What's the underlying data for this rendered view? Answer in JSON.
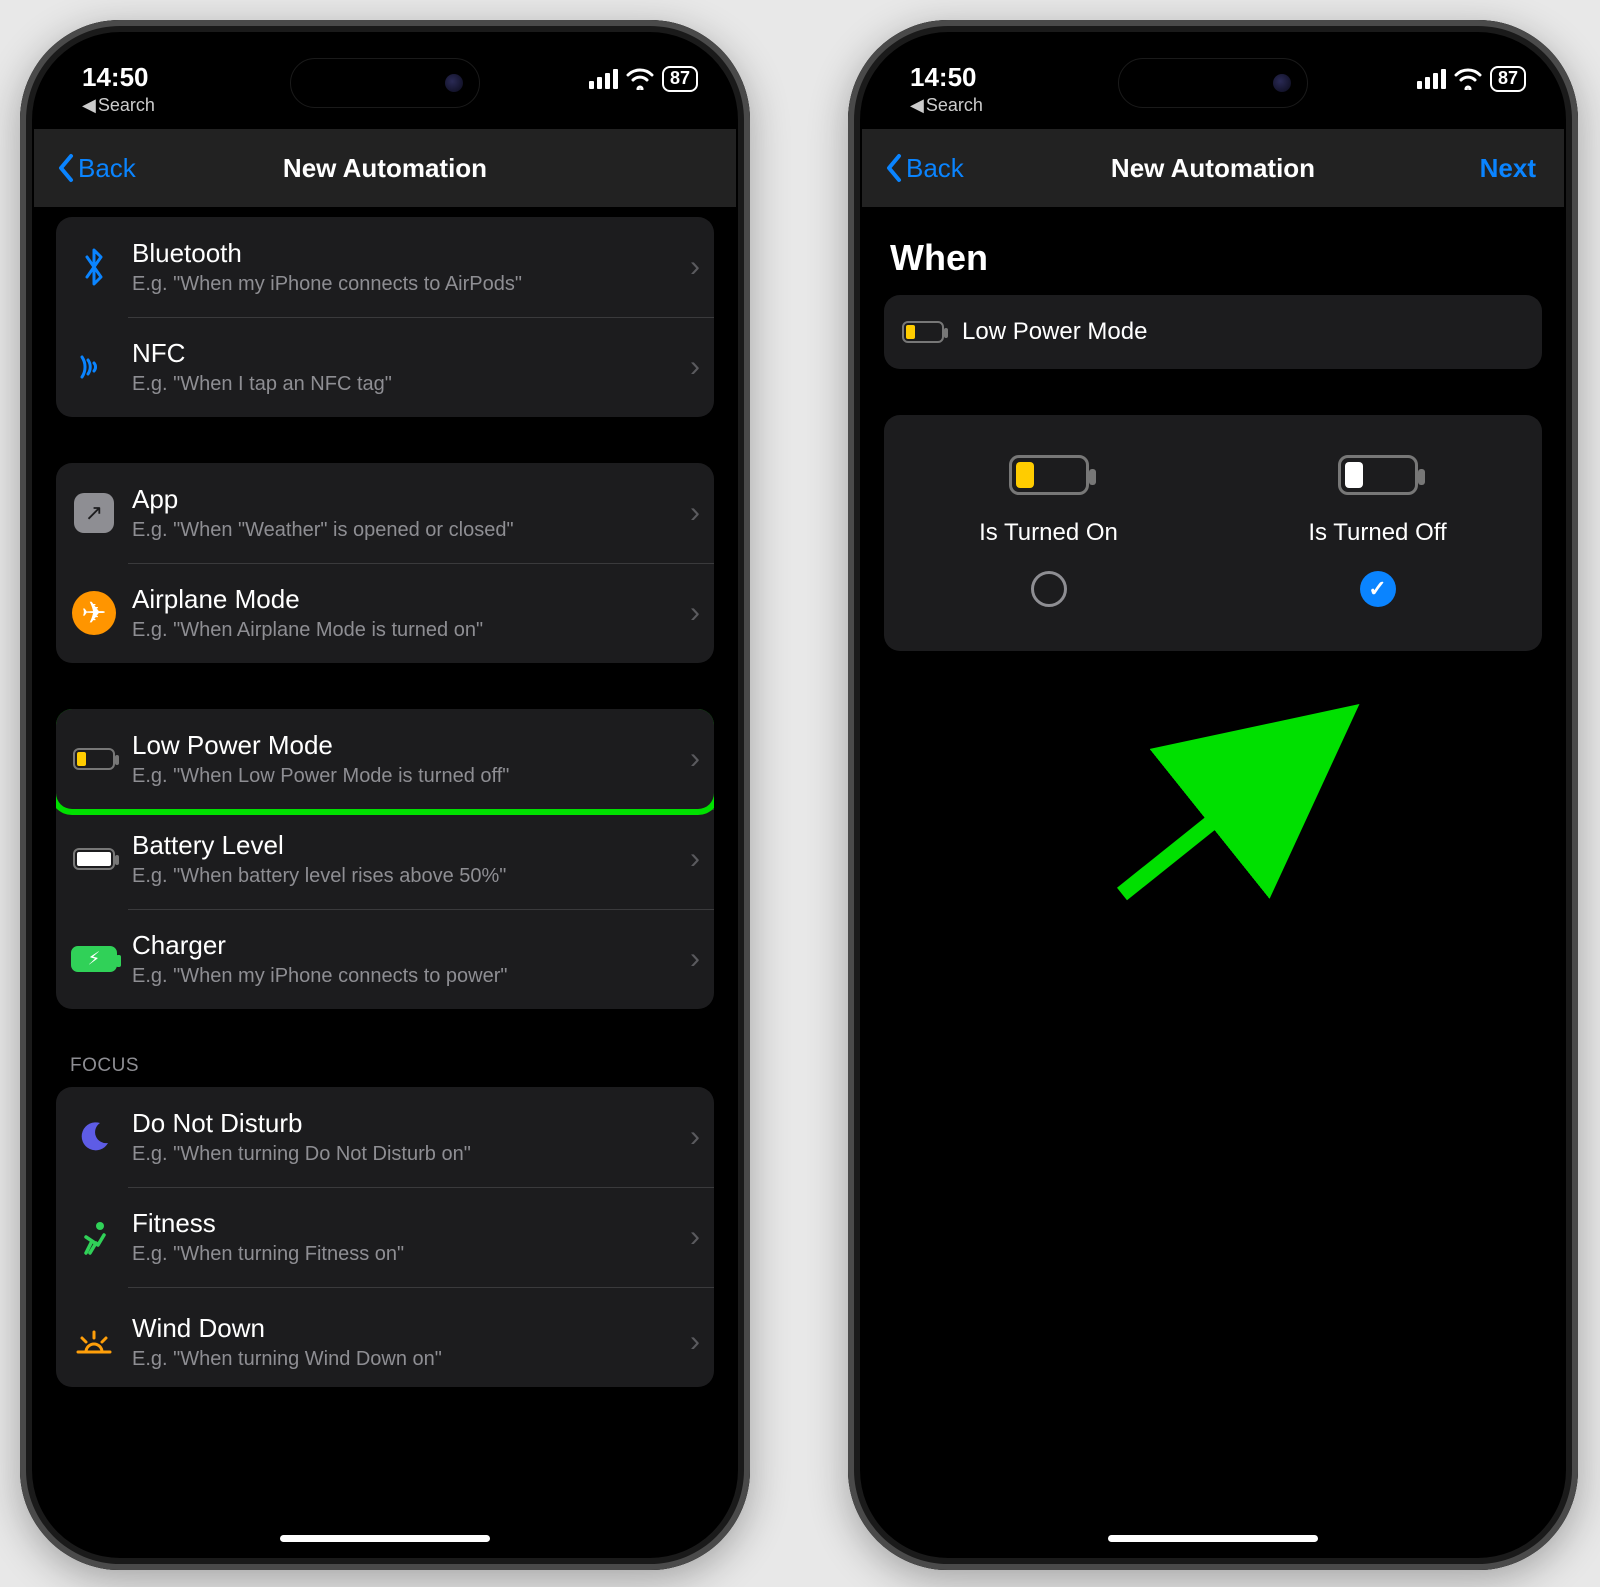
{
  "status": {
    "time": "14:50",
    "back_search": "Search",
    "battery_percent": "87"
  },
  "nav": {
    "back": "Back",
    "title": "New Automation",
    "next": "Next"
  },
  "left_screen": {
    "groups": [
      {
        "rows": [
          {
            "icon": "bluetooth",
            "title": "Bluetooth",
            "sub": "E.g. \"When my iPhone connects to AirPods\""
          },
          {
            "icon": "nfc",
            "title": "NFC",
            "sub": "E.g. \"When I tap an NFC tag\""
          }
        ]
      },
      {
        "rows": [
          {
            "icon": "app",
            "title": "App",
            "sub": "E.g. \"When \"Weather\" is opened or closed\""
          },
          {
            "icon": "airplane",
            "title": "Airplane Mode",
            "sub": "E.g. \"When Airplane Mode is turned on\""
          }
        ]
      },
      {
        "rows": [
          {
            "icon": "lpm",
            "title": "Low Power Mode",
            "sub": "E.g. \"When Low Power Mode is turned off\"",
            "highlight": true
          },
          {
            "icon": "battery",
            "title": "Battery Level",
            "sub": "E.g. \"When battery level rises above 50%\""
          },
          {
            "icon": "charger",
            "title": "Charger",
            "sub": "E.g. \"When my iPhone connects to power\""
          }
        ]
      }
    ],
    "focus_label": "FOCUS",
    "focus_rows": [
      {
        "icon": "moon",
        "title": "Do Not Disturb",
        "sub": "E.g. \"When turning Do Not Disturb on\""
      },
      {
        "icon": "fitness",
        "title": "Fitness",
        "sub": "E.g. \"When turning Fitness on\""
      },
      {
        "icon": "winddown",
        "title": "Wind Down",
        "sub": "E.g. \"When turning Wind Down on\""
      }
    ]
  },
  "right_screen": {
    "heading": "When",
    "trigger_label": "Low Power Mode",
    "options": {
      "on_label": "Is Turned On",
      "off_label": "Is Turned Off",
      "selected": "off"
    }
  }
}
